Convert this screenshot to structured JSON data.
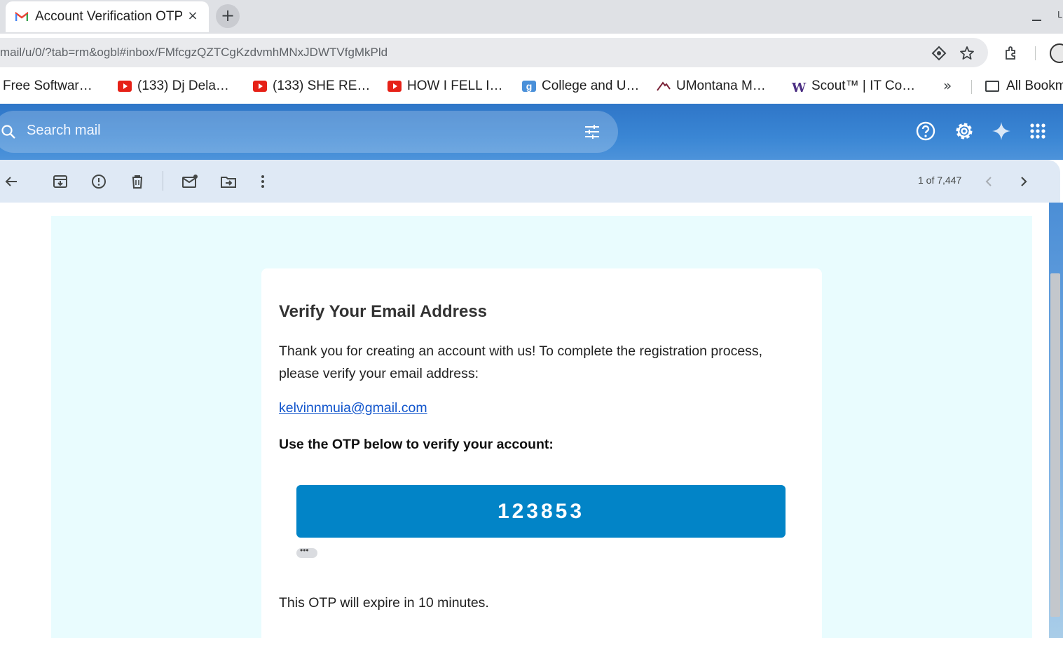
{
  "browser": {
    "tab_title": "Account Verification OTP",
    "tab_close": "×",
    "new_tab": "+",
    "url": "mail/u/0/?tab=rm&ogbl#inbox/FMfcgzQZTCgKzdvmhMNxJDWTVfgMkPld",
    "window_edge_char": "L",
    "bookmarks": [
      {
        "label": "Free Softwar…",
        "icon": "none"
      },
      {
        "label": "(133) Dj Dela…",
        "icon": "youtube-icon"
      },
      {
        "label": "(133) SHE RE…",
        "icon": "youtube-icon"
      },
      {
        "label": "HOW I FELL I…",
        "icon": "youtube-icon"
      },
      {
        "label": "College and U…",
        "icon": "g-icon"
      },
      {
        "label": "UMontana M…",
        "icon": "umontana-icon"
      },
      {
        "label": "Scout™ | IT Co…",
        "icon": "w-icon"
      }
    ],
    "bookmarks_more": "»",
    "all_bookmarks": "All Bookm"
  },
  "gmail": {
    "search_placeholder": "Search mail",
    "pager": "1 of 7,447",
    "icons": [
      "back-icon",
      "archive-icon",
      "report-spam-icon",
      "delete-icon",
      "mark-unread-icon",
      "move-to-icon",
      "more-icon",
      "help-icon",
      "settings-icon",
      "gemini-icon",
      "apps-icon"
    ]
  },
  "message": {
    "heading": "Verify Your Email Address",
    "intro": "Thank you for creating an account with us! To complete the registration process, please verify your email address:",
    "email": "kelvinnmuia@gmail.com",
    "otp_label": "Use the OTP below to verify your account:",
    "otp": "123853",
    "expiry": "This OTP will expire in 10 minutes."
  },
  "colors": {
    "gmail_header": "#3a86d4",
    "otp_box": "#0284c7",
    "message_bg": "#e9fcfe",
    "link": "#1155cc"
  }
}
